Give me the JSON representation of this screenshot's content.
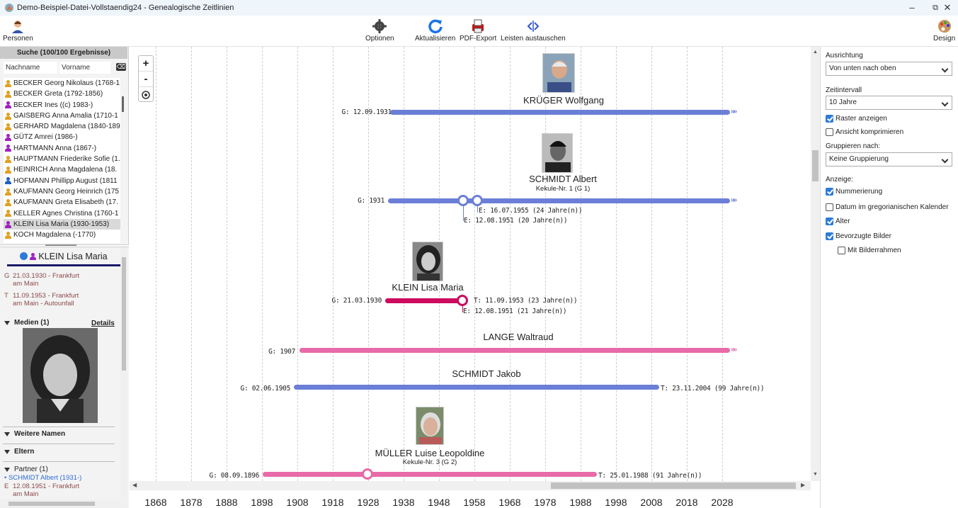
{
  "window": {
    "title": "Demo-Beispiel-Datei-Vollstaendig24 - Genealogische Zeitlinien",
    "minimize": "–",
    "restore": "⧉",
    "close": "✕"
  },
  "toolbar": {
    "persons_label": "Personen",
    "options_label": "Optionen",
    "refresh_label": "Aktualisieren",
    "pdf_label": "PDF-Export",
    "swap_label": "Leisten austauschen",
    "design_label": "Design"
  },
  "search": {
    "header": "Suche (100/100 Ergebnisse)",
    "lastname_placeholder": "Nachname",
    "firstname_placeholder": "Vorname",
    "clear": "⌫"
  },
  "person_list": [
    {
      "name": "BECKER Georg Nikolaus (1768-1",
      "color": "#e0a020"
    },
    {
      "name": "BECKER Greta (1792-1856)",
      "color": "#e0a020"
    },
    {
      "name": "BECKER Ines ((c) 1983-)",
      "color": "#a020c0"
    },
    {
      "name": "GAISBERG Anna Amalia (1710-1",
      "color": "#e0a020"
    },
    {
      "name": "GERHARD Magdalena (1840-189",
      "color": "#e0a020"
    },
    {
      "name": "GÜTZ Amrei (1986-)",
      "color": "#a020c0"
    },
    {
      "name": "HARTMANN Anna (1867-)",
      "color": "#a020c0"
    },
    {
      "name": "HAUPTMANN Friederike Sofie (1.",
      "color": "#e0a020"
    },
    {
      "name": "HEINRICH Anna Magdalena (18.",
      "color": "#e0a020"
    },
    {
      "name": "HOFMANN Phillipp August (1811",
      "color": "#2060c0"
    },
    {
      "name": "KAUFMANN Georg Heinrich (175",
      "color": "#e0a020"
    },
    {
      "name": "KAUFMANN Greta Elisabeth (17.",
      "color": "#e0a020"
    },
    {
      "name": "KELLER Agnes Christina (1760-1",
      "color": "#e0a020"
    },
    {
      "name": "KLEIN Lisa Maria (1930-1953)",
      "color": "#a020c0",
      "selected": true
    },
    {
      "name": "KOCH Magdalena (-1770)",
      "color": "#e0a020"
    }
  ],
  "detail": {
    "name": "KLEIN Lisa Maria",
    "birth_key": "G",
    "birth_line1": "21.03.1930 - Frankfurt",
    "birth_line2": "am Main",
    "death_key": "T",
    "death_line1": "11.09.1953 - Frankfurt",
    "death_line2": "am Main - Autounfall",
    "media_label": "Medien (1)",
    "details_link": "Details",
    "names_label": "Weitere Namen",
    "parents_label": "Eltern",
    "partner_label": "Partner (1)",
    "partner_bullet": "•",
    "partner_name": "SCHMIDT Albert (1931-)",
    "marriage_key": "E",
    "marriage_line1": "12.08.1951 - Frankfurt",
    "marriage_line2": "am Main"
  },
  "zoom": {
    "plus": "+",
    "minus": "-"
  },
  "colors": {
    "male": "#6b7fd7",
    "female": "#e86aa8",
    "selected": "#cc0a5e",
    "accent": "#2d7bd6"
  },
  "timeline": {
    "years": [
      "1868",
      "1878",
      "1888",
      "1898",
      "1908",
      "1918",
      "1928",
      "1938",
      "1948",
      "1958",
      "1968",
      "1978",
      "1988",
      "1998",
      "2008",
      "2018",
      "2028"
    ],
    "people": [
      {
        "name": "KRÜGER Wolfgang",
        "birth_label": "G: 12.09.1931",
        "arrows": "»»"
      },
      {
        "name": "SCHMIDT Albert",
        "sub": "Kekule-Nr. 1 (G 1)",
        "birth_label": "G: 1931",
        "arrows": "»»",
        "marriage1": "E: 16.07.1955 (24 Jahre(n))",
        "marriage2": "E: 12.08.1951 (20 Jahre(n))"
      },
      {
        "name": "KLEIN Lisa Maria",
        "birth_label": "G: 21.03.1930",
        "death_label": "T: 11.09.1953 (23 Jahre(n))",
        "marriage": "E: 12.08.1951 (21 Jahre(n))"
      },
      {
        "name": "LANGE Waltraud",
        "birth_label": "G: 1907",
        "arrows": "»»"
      },
      {
        "name": "SCHMIDT Jakob",
        "birth_label": "G: 02.06.1905",
        "death_label": "T: 23.11.2004 (99 Jahre(n))"
      },
      {
        "name": "MÜLLER Luise Leopoldine",
        "sub": "Kekule-Nr. 3 (G 2)",
        "birth_label": "G: 08.09.1896",
        "death_label": "T: 25.01.1988 (91 Jahre(n))"
      }
    ]
  },
  "settings": {
    "orientation_label": "Ausrichtung",
    "orientation_value": "Von unten nach oben",
    "interval_label": "Zeitintervall",
    "interval_value": "10 Jahre",
    "grid_label": "Raster anzeigen",
    "grid_checked": true,
    "compress_label": "Ansicht komprimieren",
    "compress_checked": false,
    "group_label": "Gruppieren nach:",
    "group_value": "Keine Gruppierung",
    "display_label": "Anzeige:",
    "numbering_label": "Nummerierung",
    "numbering_checked": true,
    "gregorian_label": "Datum im gregorianischen Kalender",
    "gregorian_checked": false,
    "age_label": "Alter",
    "age_checked": true,
    "pref_images_label": "Bevorzugte Bilder",
    "pref_images_checked": true,
    "frame_label": "Mit Bilderrahmen",
    "frame_checked": false
  }
}
